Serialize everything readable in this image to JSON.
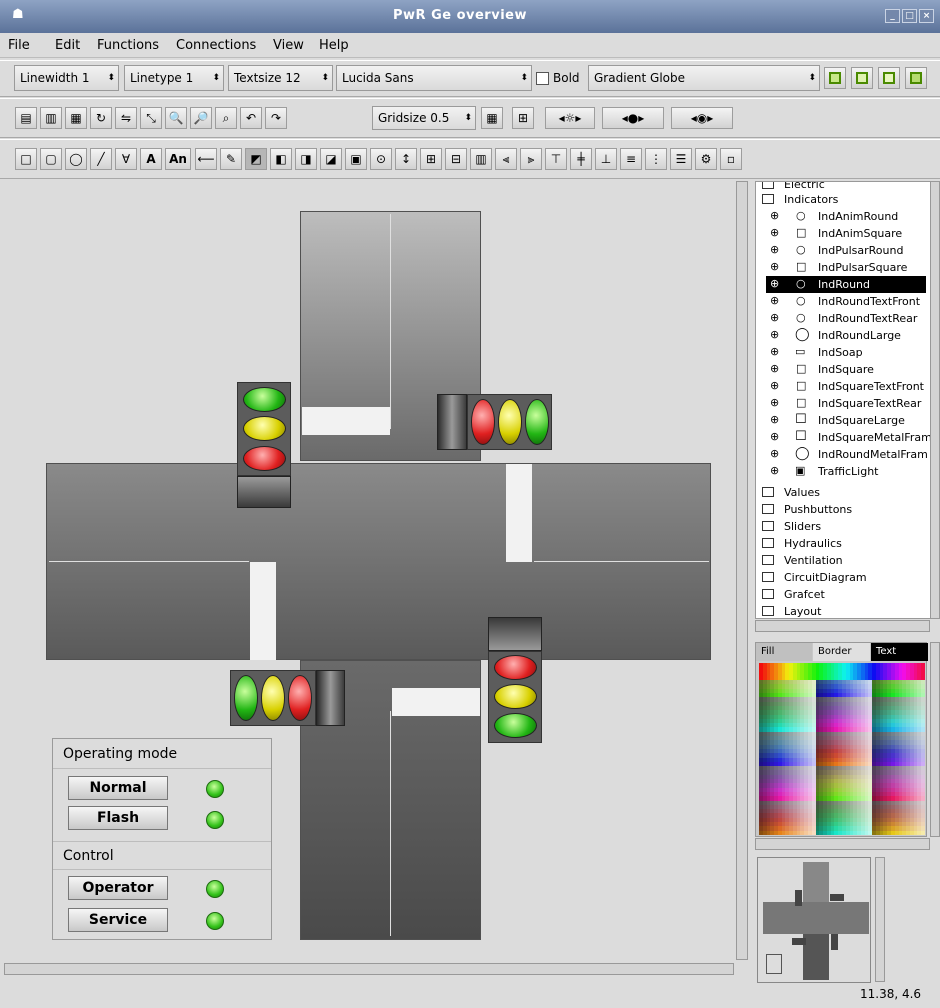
{
  "window": {
    "title": "PwR Ge   overview"
  },
  "menu": [
    "File",
    "Edit",
    "Functions",
    "Connections",
    "View",
    "Help"
  ],
  "toolbar1": {
    "linewidth": "Linewidth 1",
    "linetype": "Linetype 1",
    "textsize": "Textsize 12",
    "font": "Lucida Sans",
    "bold_label": "Bold",
    "gradient": "Gradient Globe"
  },
  "toolbar2": {
    "gridsize": "Gridsize 0.5"
  },
  "toolbar3": {
    "text_a": "A",
    "text_an": "An"
  },
  "panel": {
    "operating_mode": "Operating mode",
    "normal": "Normal",
    "flash": "Flash",
    "control": "Control",
    "operator": "Operator",
    "service": "Service"
  },
  "tree": {
    "top_cut": "Electric",
    "indicators": "Indicators",
    "items": [
      "IndAnimRound",
      "IndAnimSquare",
      "IndPulsarRound",
      "IndPulsarSquare",
      "IndRound",
      "IndRoundTextFront",
      "IndRoundTextRear",
      "IndRoundLarge",
      "IndSoap",
      "IndSquare",
      "IndSquareTextFront",
      "IndSquareTextRear",
      "IndSquareLarge",
      "IndSquareMetalFram",
      "IndRoundMetalFram",
      "TrafficLight"
    ],
    "selected": "IndRound",
    "folders": [
      "Values",
      "Pushbuttons",
      "Sliders",
      "Hydraulics",
      "Ventilation",
      "CircuitDiagram",
      "Grafcet",
      "Layout"
    ]
  },
  "palette": {
    "tabs": [
      "Fill",
      "Border",
      "Text"
    ]
  },
  "status": {
    "coords": "11.38, 4.6"
  }
}
